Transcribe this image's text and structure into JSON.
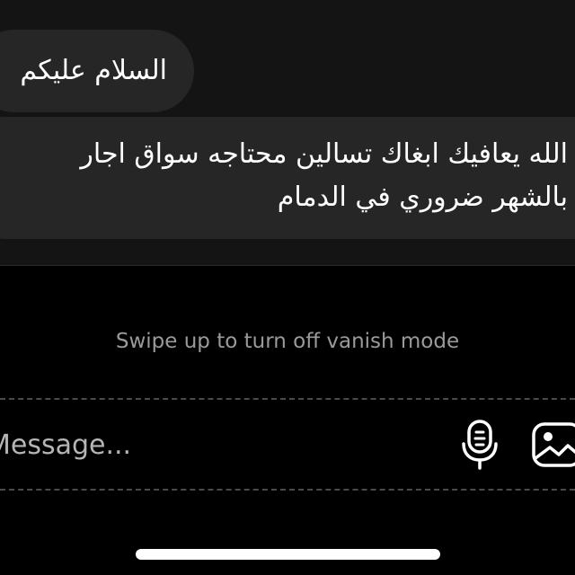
{
  "messages": [
    {
      "text": "السلام عليكم"
    },
    {
      "lines": [
        "الله يعافيك ابغاك تسالين محتاجه سواق اجار",
        "بالشهر  ضروري في الدمام"
      ]
    }
  ],
  "vanish_mode": {
    "hint": "Swipe up to turn off vanish mode"
  },
  "composer": {
    "placeholder": "Message...",
    "icons": {
      "mic": "microphone-icon",
      "photo": "photo-gallery-icon"
    }
  },
  "colors": {
    "background": "#000000",
    "chat_background": "#141414",
    "bubble": "#262626",
    "hint_text": "#9a9a9a",
    "dashed_line": "#4a4a4a"
  }
}
